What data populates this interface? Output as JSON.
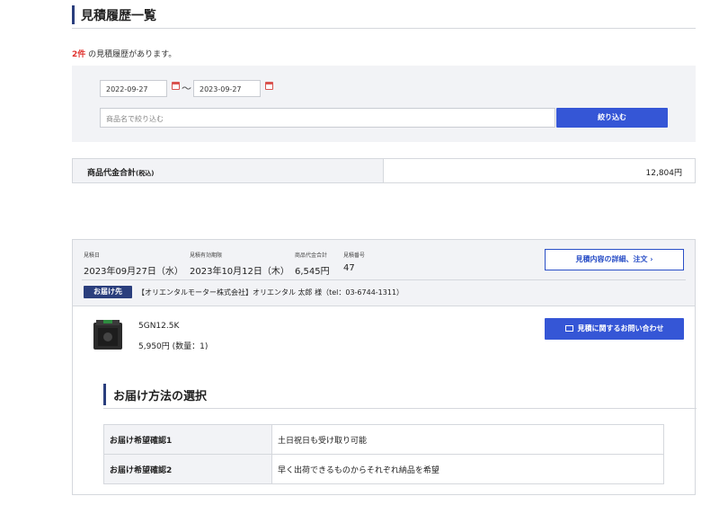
{
  "page": {
    "title": "見積履歴一覧"
  },
  "summary": {
    "count": "2件",
    "count_suffix": "の見積履歴があります。"
  },
  "filter": {
    "date_from": "2022-09-27",
    "tilde": "〜",
    "date_to": "2023-09-27",
    "keyword_placeholder": "商品名で絞り込む",
    "button_label": "絞り込む"
  },
  "total": {
    "label": "商品代金合計",
    "label_tax": "(税込)",
    "value": "12,804円"
  },
  "quote": {
    "date_label": "見積日",
    "date_value": "2023年09月27日（水）",
    "expiry_label": "見積有効期限",
    "expiry_value": "2023年10月12日（木）",
    "amount_label": "商品代金合計",
    "amount_value": "6,545円",
    "number_label": "見積番号",
    "number_value": "47",
    "detail_button": "見積内容の詳細、注文 ›",
    "delivery_badge": "お届け先",
    "delivery_text": "【オリエンタルモーター株式会社】オリエンタル 太郎 様（tel：03-6744-1311）",
    "product_name": "5GN12.5K",
    "product_price": "5,950円 (数量：1)",
    "inquiry_button": "見積に関するお問い合わせ",
    "inquiry_icon": "mail-icon",
    "section_title": "お届け方法の選択",
    "options": [
      {
        "label": "お届け希望確認1",
        "value": "土日祝日も受け取り可能"
      },
      {
        "label": "お届け希望確認2",
        "value": "早く出荷できるものからそれぞれ納品を希望"
      }
    ]
  },
  "colors": {
    "accent_blue": "#3556d6",
    "navy": "#2a3e7d",
    "red": "#e0332f",
    "panel_bg": "#f2f3f6"
  }
}
